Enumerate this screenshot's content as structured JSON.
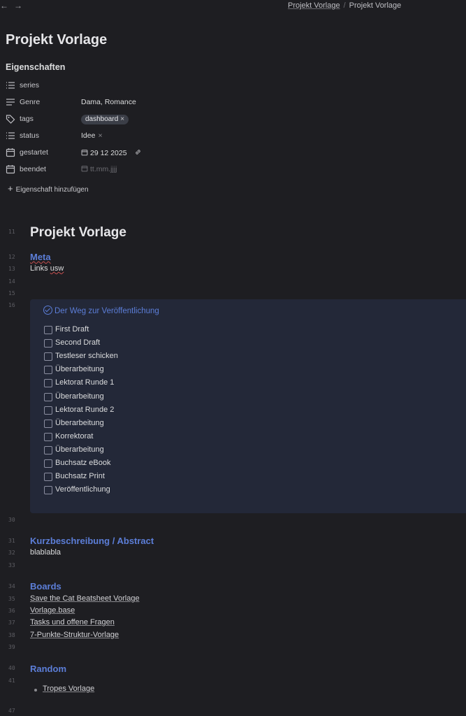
{
  "nav": {
    "back_icon": "←",
    "forward_icon": "→"
  },
  "breadcrumb": {
    "parent": "Projekt Vorlage",
    "separator": "/",
    "current": "Projekt Vorlage"
  },
  "page_title": "Projekt Vorlage",
  "properties": {
    "heading": "Eigenschaften",
    "series": {
      "key": "series",
      "value": "",
      "icon": "list-icon"
    },
    "genre": {
      "key": "Genre",
      "value": "Dama, Romance",
      "icon": "text-icon"
    },
    "tags": {
      "key": "tags",
      "icon": "tag-icon",
      "pill": "dashboard",
      "pill_remove": "×"
    },
    "status": {
      "key": "status",
      "value": "Idee",
      "remove": "×",
      "icon": "list-icon"
    },
    "gestartet": {
      "key": "gestartet",
      "value": "29 12 2025",
      "icon": "calendar-icon"
    },
    "beendet": {
      "key": "beendet",
      "placeholder": "tt.mm.jjjj",
      "icon": "calendar-icon"
    },
    "add_label": "Eigenschaft hinzufügen",
    "add_icon": "+"
  },
  "editor": {
    "line_numbers": {
      "l11": "11",
      "l12": "12",
      "l13": "13",
      "l14": "14",
      "l15": "15",
      "l16": "16",
      "l30": "30",
      "l31": "31",
      "l32": "32",
      "l33": "33",
      "l34": "34",
      "l35": "35",
      "l36": "36",
      "l37": "37",
      "l38": "38",
      "l39": "39",
      "l40": "40",
      "l41": "41",
      "l47": "47"
    },
    "h1": "Projekt Vorlage",
    "meta_heading": "Meta",
    "meta_text_a": "Links ",
    "meta_text_b": "usw",
    "callout": {
      "title": "Der Weg zur Veröffentlichung",
      "tasks": [
        "First Draft",
        "Second Draft",
        "Testleser schicken",
        "Überarbeitung",
        "Lektorat Runde 1",
        "Überarbeitung",
        "Lektorat Runde 2",
        "Überarbeitung",
        "Korrektorat",
        "Überarbeitung",
        "Buchsatz eBook",
        "Buchsatz Print",
        "Veröffentlichung"
      ]
    },
    "abstract_heading_a": "Kurzbeschreibung",
    "abstract_heading_b": " / ",
    "abstract_heading_c": "Abstract",
    "abstract_text": "blablabla",
    "boards_heading": "Boards",
    "boards_links": {
      "l1a": "Save the Cat ",
      "l1b": "Beatsheet",
      "l1c": " Vorlage",
      "l2a": "Vorlage",
      "l2b": ".base",
      "l3": "Tasks und offene Fragen",
      "l4": "7-Punkte-Struktur-Vorlage"
    },
    "random_heading": "Random",
    "random_link": "Tropes Vorlage"
  },
  "colors": {
    "background": "#1e1e22",
    "accent": "#5c7ed8",
    "callout_bg": "#232838"
  }
}
